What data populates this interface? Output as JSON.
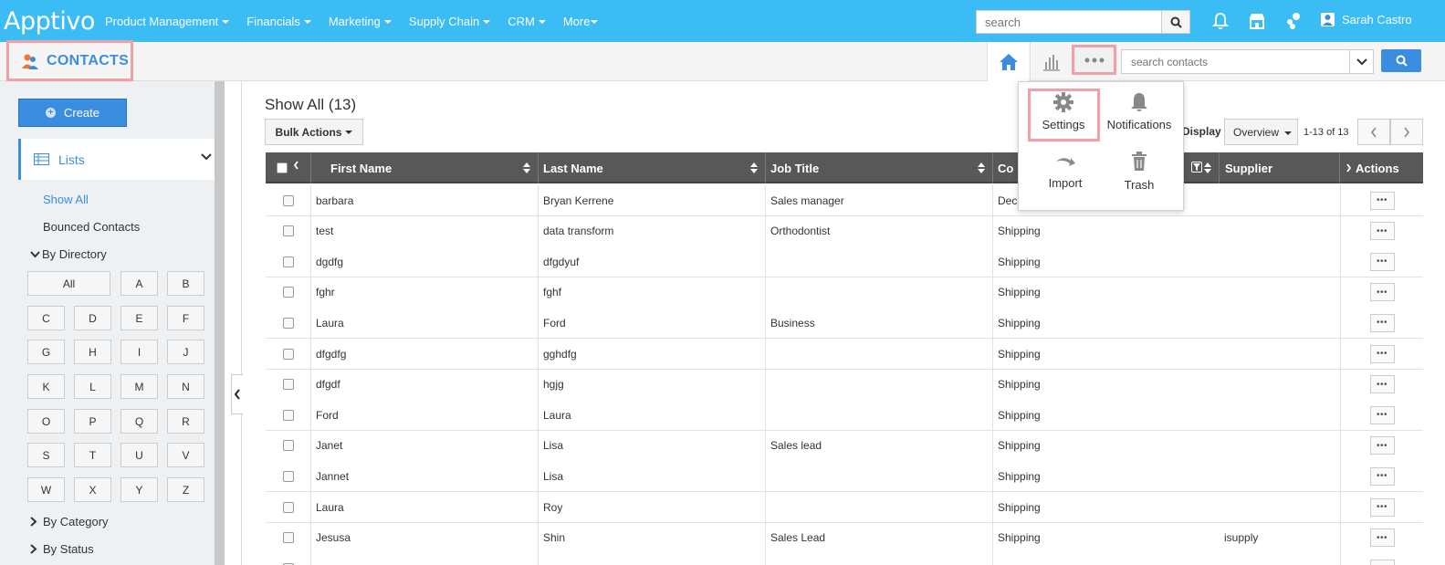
{
  "brand": "Apptivo",
  "nav": [
    "Product Management",
    "Financials",
    "Marketing",
    "Supply Chain",
    "CRM",
    "More"
  ],
  "global_search_placeholder": "search",
  "user_name": "Sarah Castro",
  "app_title": "CONTACTS",
  "contact_search_placeholder": "search contacts",
  "sidebar": {
    "create_label": "Create",
    "lists_label": "Lists",
    "show_all": "Show All",
    "bounced": "Bounced Contacts",
    "by_directory": "By Directory",
    "directory": [
      "All",
      "A",
      "B",
      "C",
      "D",
      "E",
      "F",
      "G",
      "H",
      "I",
      "J",
      "K",
      "L",
      "M",
      "N",
      "O",
      "P",
      "Q",
      "R",
      "S",
      "T",
      "U",
      "V",
      "W",
      "X",
      "Y",
      "Z"
    ],
    "by_category": "By Category",
    "by_status": "By Status"
  },
  "main": {
    "title": "Show All (13)",
    "bulk_actions": "Bulk Actions",
    "display_label": "Display",
    "display_value": "Overview",
    "pager_text": "1-13 of 13"
  },
  "menu": {
    "settings": "Settings",
    "notifications": "Notifications",
    "import": "Import",
    "trash": "Trash"
  },
  "table": {
    "columns": [
      "First Name",
      "Last Name",
      "Job Title",
      "Co",
      "Supplier",
      "Actions"
    ],
    "rows": [
      [
        "barbara",
        "Bryan Kerrene",
        "Sales manager",
        "Dec",
        ""
      ],
      [
        "test",
        "data transform",
        "Orthodontist",
        "Shipping",
        ""
      ],
      [
        "dgdfg",
        "dfgdyuf",
        "",
        "Shipping",
        ""
      ],
      [
        "fghr",
        "fghf",
        "",
        "Shipping",
        ""
      ],
      [
        "Laura",
        "Ford",
        "Business",
        "Shipping",
        ""
      ],
      [
        "dfgdfg",
        "gghdfg",
        "",
        "Shipping",
        ""
      ],
      [
        "dfgdf",
        "hgjg",
        "",
        "Shipping",
        ""
      ],
      [
        "Ford",
        "Laura",
        "",
        "Shipping",
        ""
      ],
      [
        "Janet",
        "Lisa",
        "Sales lead",
        "Shipping",
        ""
      ],
      [
        "Jannet",
        "Lisa",
        "",
        "Shipping",
        ""
      ],
      [
        "Laura",
        "Roy",
        "",
        "Shipping",
        ""
      ],
      [
        "Jesusa",
        "Shin",
        "Sales Lead",
        "Shipping",
        "isupply"
      ],
      [
        "",
        "",
        "",
        "",
        ""
      ]
    ]
  },
  "colors": {
    "nav_bg": "#3bbcf4",
    "accent": "#3b8de0",
    "highlight": "#f2a0a6"
  }
}
